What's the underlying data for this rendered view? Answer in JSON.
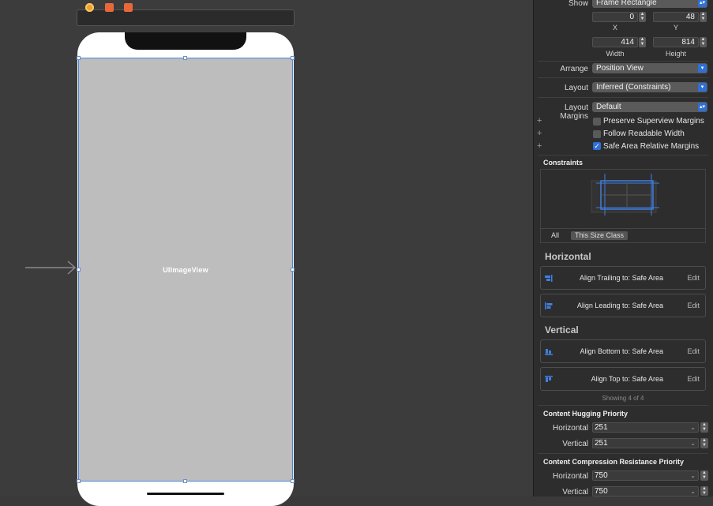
{
  "canvas": {
    "image_view_label": "UIImageView"
  },
  "inspector": {
    "show": {
      "label": "Show",
      "value": "Frame Rectangle"
    },
    "frame": {
      "x": "0",
      "y": "48",
      "width": "414",
      "height": "814",
      "x_label": "X",
      "y_label": "Y",
      "width_label": "Width",
      "height_label": "Height"
    },
    "arrange": {
      "label": "Arrange",
      "value": "Position View"
    },
    "layout": {
      "label": "Layout",
      "value": "Inferred (Constraints)"
    },
    "layout_margins": {
      "label": "Layout Margins",
      "value": "Default"
    },
    "checkboxes": [
      {
        "label": "Preserve Superview Margins",
        "checked": false
      },
      {
        "label": "Follow Readable Width",
        "checked": false
      },
      {
        "label": "Safe Area Relative Margins",
        "checked": true
      }
    ],
    "constraints": {
      "title": "Constraints",
      "tab_all": "All",
      "tab_size_class": "This Size Class"
    },
    "horizontal": {
      "title": "Horizontal",
      "items": [
        {
          "text": "Align Trailing to:  Safe Area",
          "edit": "Edit"
        },
        {
          "text": "Align Leading to:  Safe Area",
          "edit": "Edit"
        }
      ]
    },
    "vertical": {
      "title": "Vertical",
      "items": [
        {
          "text": "Align Bottom to:  Safe Area",
          "edit": "Edit"
        },
        {
          "text": "Align Top to:  Safe Area",
          "edit": "Edit"
        }
      ]
    },
    "showing": "Showing 4 of 4",
    "hugging": {
      "title": "Content Hugging Priority",
      "horizontal_label": "Horizontal",
      "horizontal_value": "251",
      "vertical_label": "Vertical",
      "vertical_value": "251"
    },
    "compression": {
      "title": "Content Compression Resistance Priority",
      "horizontal_label": "Horizontal",
      "horizontal_value": "750",
      "vertical_label": "Vertical",
      "vertical_value": "750"
    }
  },
  "colors": {
    "accent": "#2f6fd6",
    "selection_border": "#4a86d8",
    "image_view_fill": "#bdbdbe"
  }
}
